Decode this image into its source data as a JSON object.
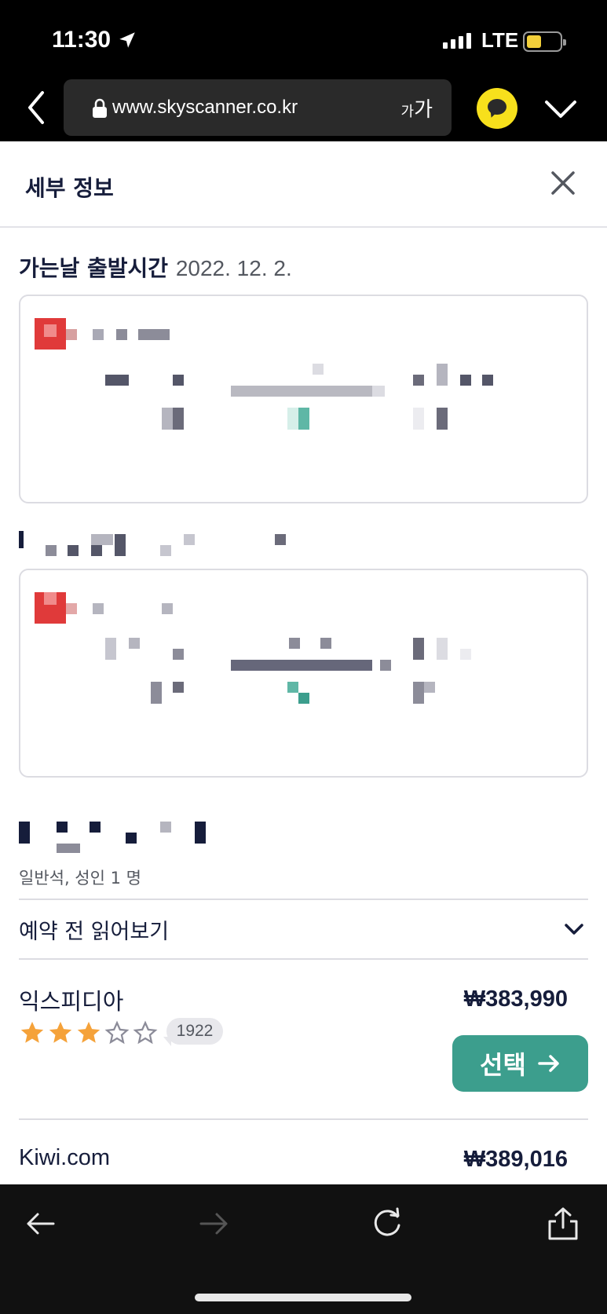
{
  "status_bar": {
    "time": "11:30",
    "network": "LTE"
  },
  "browser": {
    "url": "www.skyscanner.co.kr",
    "text_size_label_small": "가",
    "text_size_label_large": "가"
  },
  "detail": {
    "title": "세부 정보"
  },
  "outbound": {
    "label": "가는날 출발시간",
    "date": "2022. 12. 2."
  },
  "cabin_info": "일반석, 성인 1 명",
  "before_booking": "예약 전 읽어보기",
  "providers": [
    {
      "name": "익스피디아",
      "price": "₩383,990",
      "rating": 3,
      "max_rating": 5,
      "reviews": "1922",
      "select_label": "선택"
    },
    {
      "name": "Kiwi.com",
      "price": "₩389,016"
    }
  ],
  "colors": {
    "brand_dark": "#161d3b",
    "accent_green": "#3c9e8d",
    "star": "#f5a23a",
    "airline_red": "#e03a3a"
  }
}
